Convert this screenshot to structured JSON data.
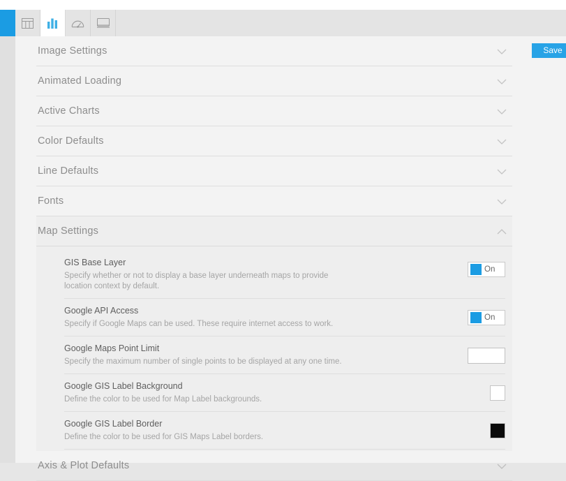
{
  "theme": {
    "accent": "#1b9ce3",
    "save_button_color": "#28a3e6",
    "page_background": "#f3f3f3",
    "panel_background": "#eeeeee"
  },
  "tabbar": {
    "tabs": [
      {
        "icon": "table-icon",
        "name": "tab-table",
        "active": false
      },
      {
        "icon": "bar-chart-icon",
        "name": "tab-charts",
        "active": true
      },
      {
        "icon": "gauge-icon",
        "name": "tab-gauge",
        "active": false
      },
      {
        "icon": "monitor-icon",
        "name": "tab-display",
        "active": false
      }
    ]
  },
  "toolbar": {
    "save_label": "Save"
  },
  "accordion": {
    "sections": [
      {
        "title": "Image Settings",
        "expanded": false,
        "chevron": "chevron-down-icon"
      },
      {
        "title": "Animated Loading",
        "expanded": false,
        "chevron": "chevron-down-icon"
      },
      {
        "title": "Active Charts",
        "expanded": false,
        "chevron": "chevron-down-icon"
      },
      {
        "title": "Color Defaults",
        "expanded": false,
        "chevron": "chevron-down-icon"
      },
      {
        "title": "Line Defaults",
        "expanded": false,
        "chevron": "chevron-down-icon"
      },
      {
        "title": "Fonts",
        "expanded": false,
        "chevron": "chevron-down-icon"
      },
      {
        "title": "Map Settings",
        "expanded": true,
        "chevron": "chevron-up-icon"
      },
      {
        "title": "Axis & Plot Defaults",
        "expanded": false,
        "chevron": "chevron-down-icon"
      }
    ]
  },
  "map_settings": {
    "rows": [
      {
        "label": "GIS Base Layer",
        "description": "Specify whether or not to display a base layer underneath maps to provide location context by default.",
        "control": "toggle",
        "value": "On"
      },
      {
        "label": "Google API Access",
        "description": "Specify if Google Maps can be used. These require internet access to work.",
        "control": "toggle",
        "value": "On"
      },
      {
        "label": "Google Maps Point Limit",
        "description": "Specify the maximum number of single points to be displayed at any one time.",
        "control": "text-input",
        "value": "",
        "placeholder": ""
      },
      {
        "label": "Google GIS Label Background",
        "description": "Define the color to be used for Map Label backgrounds.",
        "control": "color-swatch",
        "value": "#ffffff"
      },
      {
        "label": "Google GIS Label Border",
        "description": "Define the color to be used for GIS Maps Label borders.",
        "control": "color-swatch",
        "value": "#0a0a0a"
      }
    ]
  }
}
